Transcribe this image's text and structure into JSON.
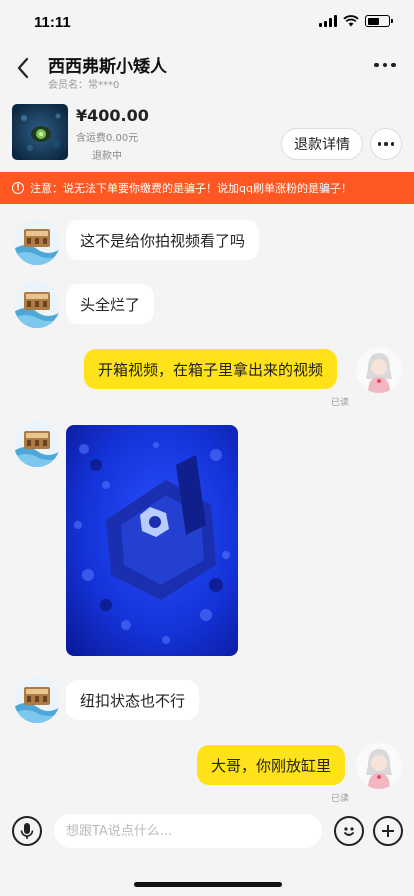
{
  "status_bar": {
    "time": "11:11",
    "battery_level": 0.55
  },
  "header": {
    "chat_name": "西西弗斯小矮人",
    "member_line": "会员名：常***0"
  },
  "product": {
    "price": "¥400.00",
    "shipping": "含运费0.00元",
    "status": "退款中",
    "refund_button": "退款详情"
  },
  "warning": {
    "icon": "!",
    "text": "注意：说无法下单要你缴费的是骗子！说加qq刷单涨粉的是骗子！"
  },
  "messages": [
    {
      "side": "in",
      "text": "这不是给你拍视频看了吗"
    },
    {
      "side": "in",
      "text": "头全烂了"
    },
    {
      "side": "out",
      "text": "开箱视频，在箱子里拿出来的视频",
      "read": "已读"
    },
    {
      "side": "in",
      "type": "image",
      "image_icon": "photo-icon"
    },
    {
      "side": "in",
      "text": "纽扣状态也不行"
    },
    {
      "side": "out",
      "text": "大哥，你刚放缸里",
      "read": "已读"
    }
  ],
  "input": {
    "placeholder": "想跟TA说点什么..."
  },
  "colors": {
    "accent_yellow": "#ffe21a",
    "warning_orange": "#ff5722",
    "background": "#f4f4f4"
  }
}
